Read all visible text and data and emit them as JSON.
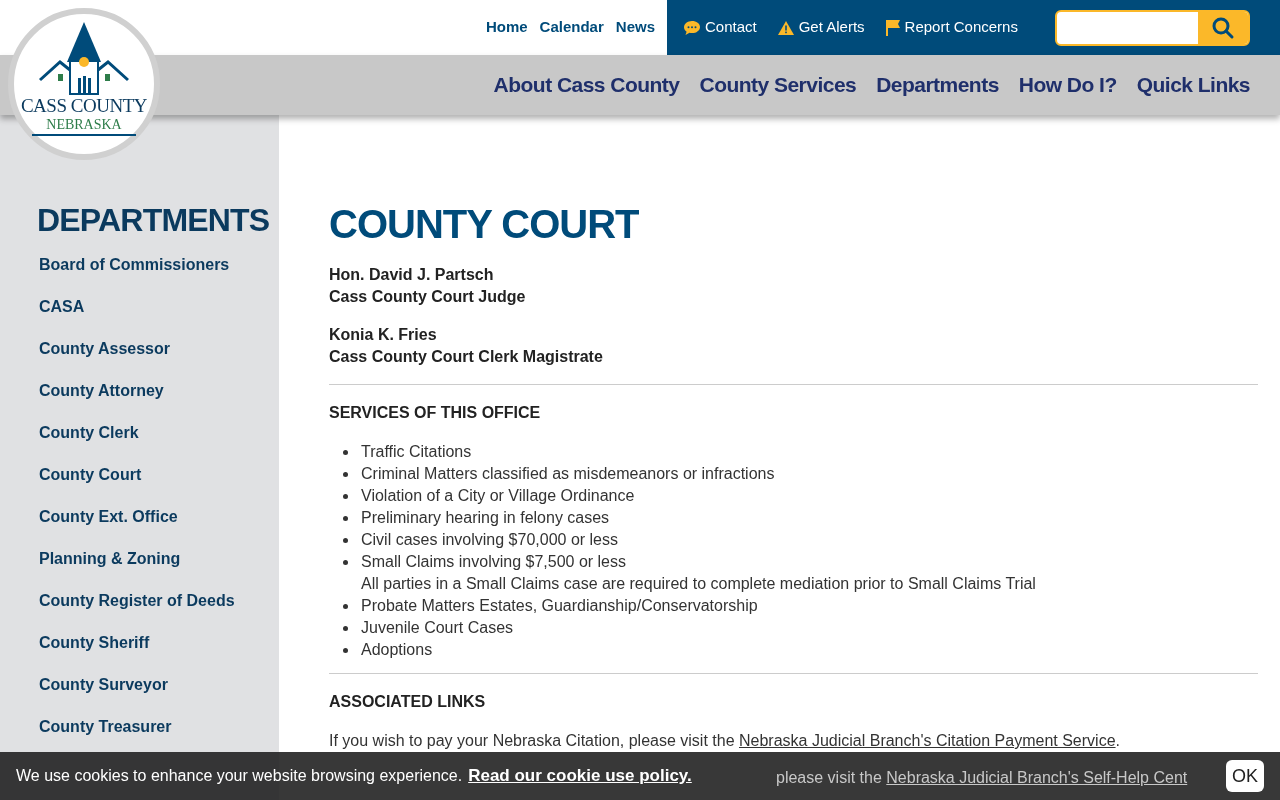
{
  "logo": {
    "line1": "CASS COUNTY",
    "line2": "NEBRASKA"
  },
  "top_links": [
    "Home",
    "Calendar",
    "News"
  ],
  "utility_links": [
    {
      "kind": "chat",
      "label": "Contact"
    },
    {
      "kind": "alert",
      "label": "Get Alerts"
    },
    {
      "kind": "flag",
      "label": "Report Concerns"
    }
  ],
  "main_nav": [
    "About Cass County",
    "County Services",
    "Departments",
    "How Do I?",
    "Quick Links"
  ],
  "sidebar": {
    "title": "DEPARTMENTS",
    "items": [
      "Board of Commissioners",
      "CASA",
      "County Assessor",
      "County Attorney",
      "County Clerk",
      "County Court",
      "County Ext. Office",
      "Planning & Zoning",
      "County Register of Deeds",
      "County Sheriff",
      "County Surveyor",
      "County Treasurer"
    ]
  },
  "page_title": "COUNTY COURT",
  "people": [
    {
      "name": "Hon. David J. Partsch",
      "role": "Cass County Court Judge"
    },
    {
      "name": "Konia K. Fries",
      "role": "Cass County Court Clerk Magistrate"
    }
  ],
  "services": {
    "heading": "SERVICES OF THIS OFFICE",
    "items": [
      {
        "text": "Traffic Citations"
      },
      {
        "text": "Criminal Matters classified as misdemeanors or infractions"
      },
      {
        "text": "Violation of a City or Village Ordinance"
      },
      {
        "text": "Preliminary hearing in felony cases"
      },
      {
        "text": "Civil cases involving $70,000 or less"
      },
      {
        "text": "Small Claims involving $7,500 or less",
        "note": "All parties in a Small Claims case are required to complete mediation prior to Small Claims Trial"
      },
      {
        "text": "Probate Matters Estates, Guardianship/Conservatorship"
      },
      {
        "text": "Juvenile Court Cases"
      },
      {
        "text": "Adoptions"
      }
    ]
  },
  "links": {
    "heading": "ASSOCIATED LINKS",
    "paragraphs": [
      {
        "text": "If you wish to pay your Nebraska Citation, please visit the",
        "link": "Nebraska Judicial Branch's Citation Payment Service",
        "after": "."
      },
      {
        "text": "please visit the",
        "link": "Nebraska Judicial Branch's Self-Help Cent"
      }
    ]
  },
  "cookie": {
    "text": "We use cookies to enhance your website browsing experience.",
    "link": "Read our cookie use policy.",
    "button": "OK"
  }
}
